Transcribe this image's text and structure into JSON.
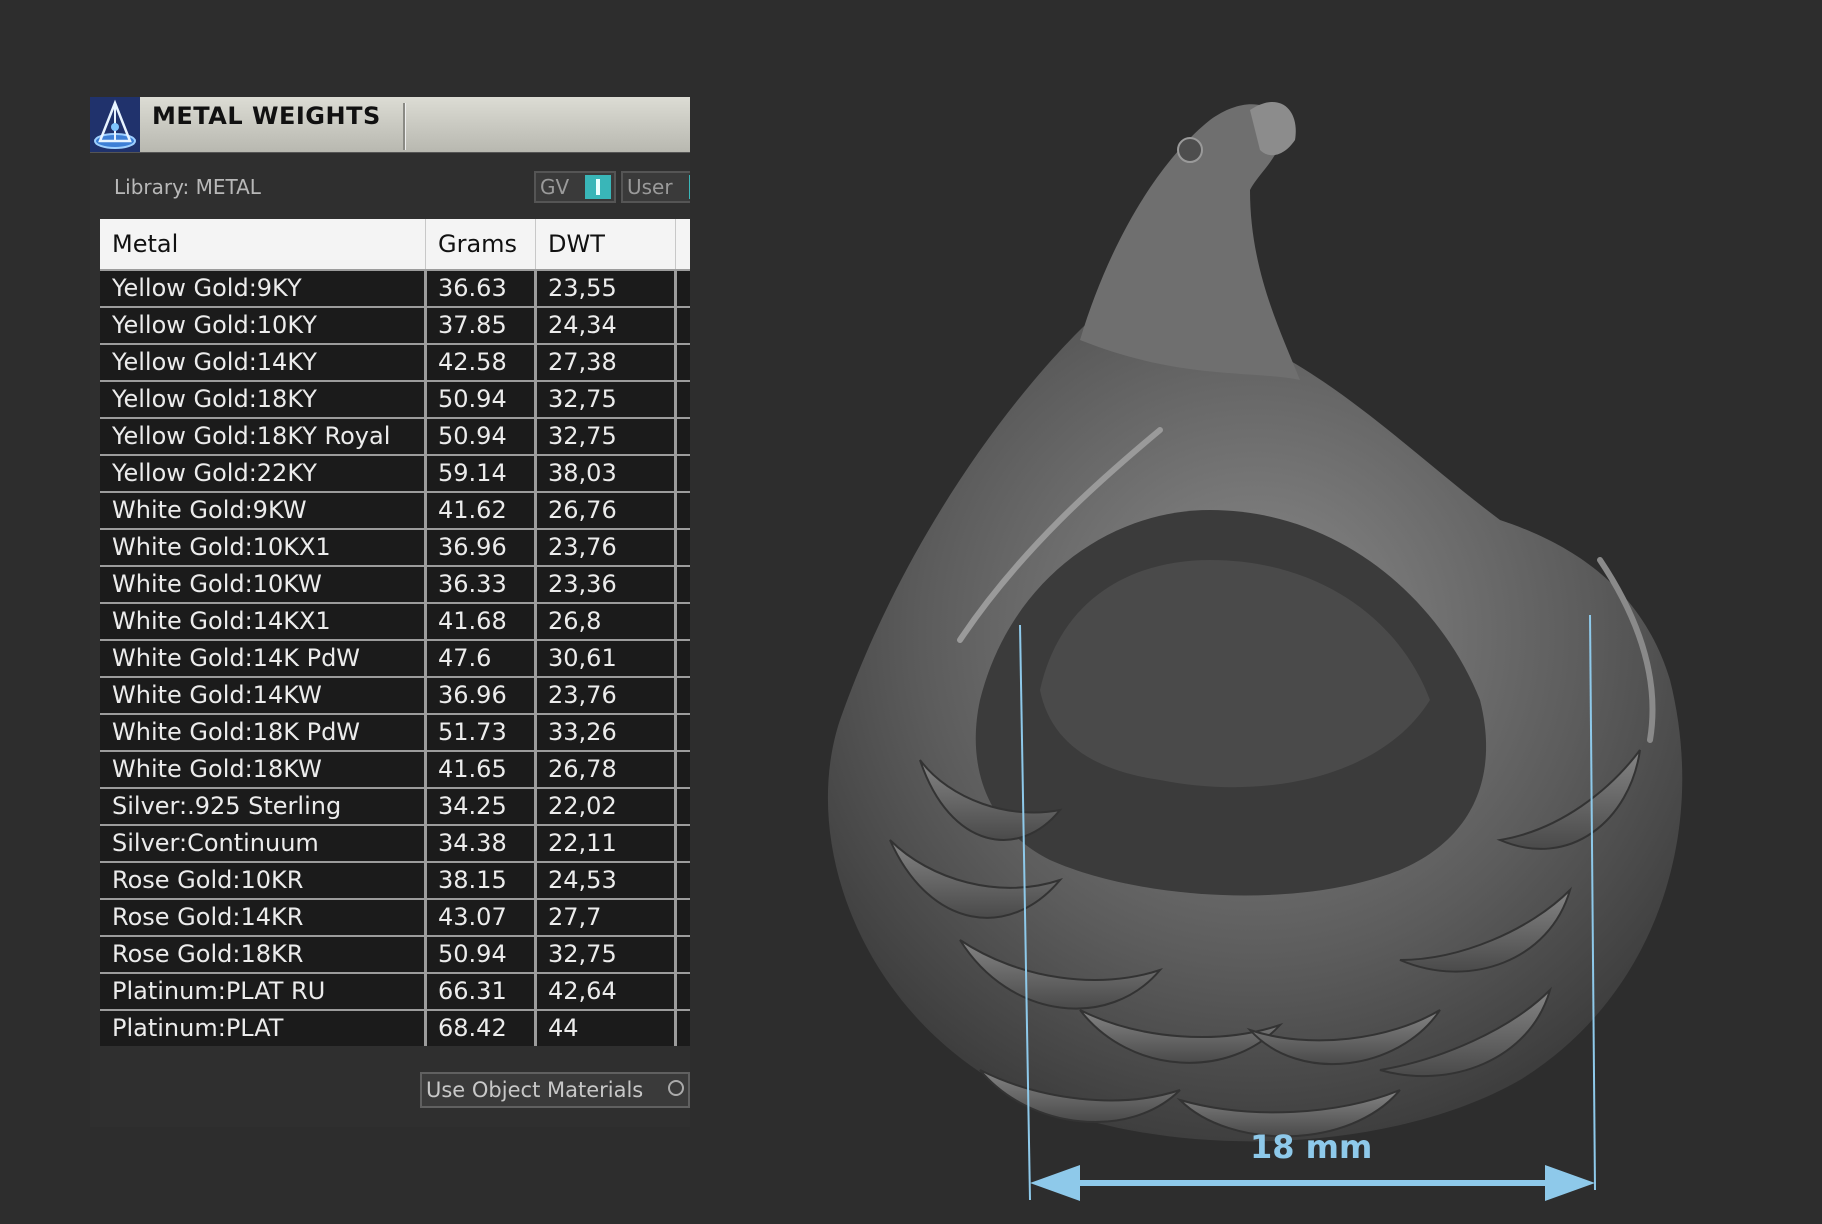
{
  "panel": {
    "title": "METAL WEIGHTS",
    "library_label": "Library: METAL",
    "toggles": {
      "gv": "GV",
      "user": "User"
    },
    "bottom_button": "Use Object Materials"
  },
  "table": {
    "headers": {
      "metal": "Metal",
      "grams": "Grams",
      "dwt": "DWT"
    },
    "rows": [
      {
        "metal": "Yellow Gold:9KY",
        "grams": "36.63",
        "dwt": "23,55"
      },
      {
        "metal": "Yellow Gold:10KY",
        "grams": "37.85",
        "dwt": "24,34"
      },
      {
        "metal": "Yellow Gold:14KY",
        "grams": "42.58",
        "dwt": "27,38"
      },
      {
        "metal": "Yellow Gold:18KY",
        "grams": "50.94",
        "dwt": "32,75"
      },
      {
        "metal": "Yellow Gold:18KY Royal",
        "grams": "50.94",
        "dwt": "32,75"
      },
      {
        "metal": "Yellow Gold:22KY",
        "grams": "59.14",
        "dwt": "38,03"
      },
      {
        "metal": "White Gold:9KW",
        "grams": "41.62",
        "dwt": "26,76"
      },
      {
        "metal": "White Gold:10KX1",
        "grams": "36.96",
        "dwt": "23,76"
      },
      {
        "metal": "White Gold:10KW",
        "grams": "36.33",
        "dwt": "23,36"
      },
      {
        "metal": "White Gold:14KX1",
        "grams": "41.68",
        "dwt": "26,8"
      },
      {
        "metal": "White Gold:14K PdW",
        "grams": "47.6",
        "dwt": "30,61"
      },
      {
        "metal": "White Gold:14KW",
        "grams": "36.96",
        "dwt": "23,76"
      },
      {
        "metal": "White Gold:18K PdW",
        "grams": "51.73",
        "dwt": "33,26"
      },
      {
        "metal": "White Gold:18KW",
        "grams": "41.65",
        "dwt": "26,78"
      },
      {
        "metal": "Silver:.925 Sterling",
        "grams": "34.25",
        "dwt": "22,02"
      },
      {
        "metal": "Silver:Continuum",
        "grams": "34.38",
        "dwt": "22,11"
      },
      {
        "metal": "Rose Gold:10KR",
        "grams": "38.15",
        "dwt": "24,53"
      },
      {
        "metal": "Rose Gold:14KR",
        "grams": "43.07",
        "dwt": "27,7"
      },
      {
        "metal": "Rose Gold:18KR",
        "grams": "50.94",
        "dwt": "32,75"
      },
      {
        "metal": "Platinum:PLAT RU",
        "grams": "66.31",
        "dwt": "42,64"
      },
      {
        "metal": "Platinum:PLAT",
        "grams": "68.42",
        "dwt": "44"
      }
    ]
  },
  "render": {
    "measurement_label": "18 mm",
    "colors": {
      "accent": "#39b6b8",
      "dimension_line": "#8ec9ea",
      "sculpt": "#6b6b6b"
    }
  }
}
